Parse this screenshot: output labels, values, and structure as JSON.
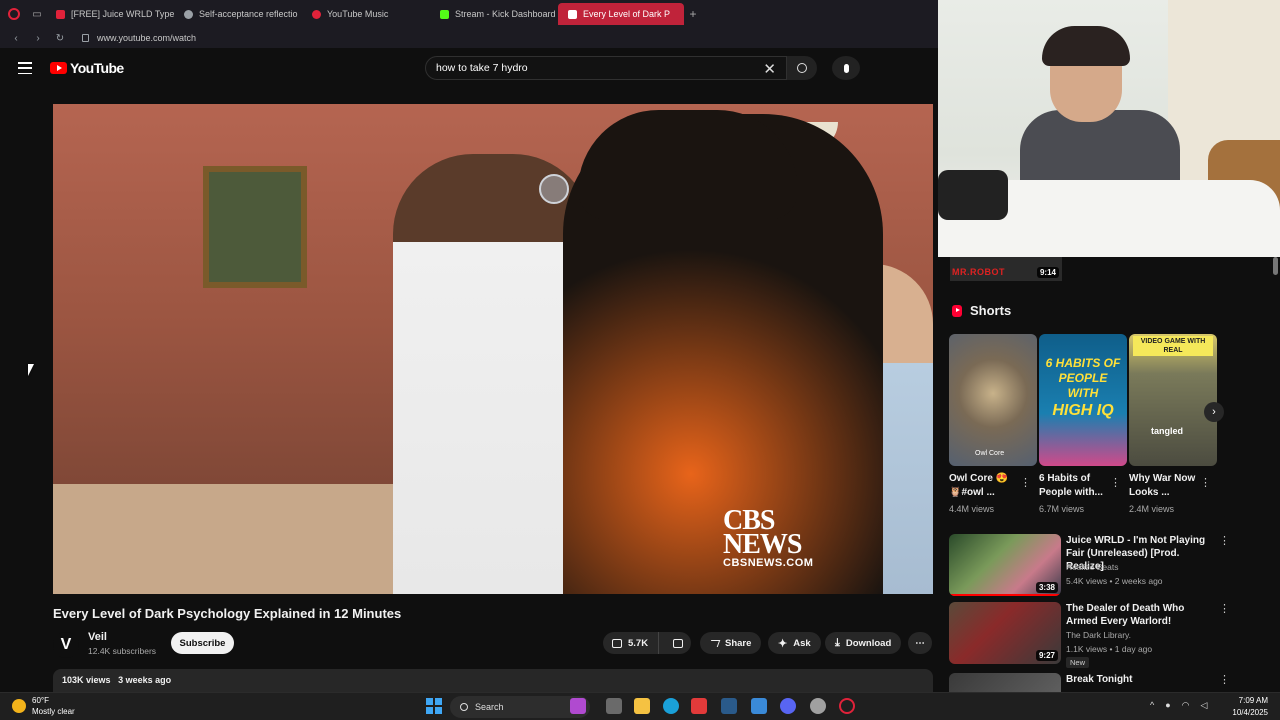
{
  "browser": {
    "tabs": [
      {
        "label": "[FREE] Juice WRLD Type",
        "color": "#e0223a",
        "active": false
      },
      {
        "label": "Self-acceptance reflectio",
        "color": "#9aa0a6",
        "active": false
      },
      {
        "label": "YouTube Music",
        "color": "#e0223a",
        "active": false
      },
      {
        "label": "Stream - Kick Dashboard",
        "color": "#53fc18",
        "active": false
      },
      {
        "label": "Every Level of Dark P",
        "color": "#ffffff",
        "active": true
      }
    ],
    "new_tab_label": "+",
    "url": "www.youtube.com/watch"
  },
  "youtube": {
    "logo_text": "YouTube",
    "search_value": "how to take 7 hydro",
    "clear_glyph": "✕"
  },
  "player": {
    "watermark_big": "CBS",
    "watermark_big2": "NEWS",
    "watermark_small": "CBSNEWS.COM"
  },
  "video": {
    "title": "Every Level of Dark Psychology Explained in 12 Minutes",
    "channel_initial": "V",
    "channel_name": "Veil",
    "subscribers": "12.4K subscribers",
    "subscribe_label": "Subscribe",
    "likes": "5.7K",
    "share_label": "Share",
    "ask_label": "Ask",
    "download_label": "Download",
    "more_glyph": "⋯",
    "views": "103K views",
    "age": "3 weeks ago"
  },
  "sidebar": {
    "prev_thumb_text": "MR.ROBOT",
    "prev_duration": "9:14",
    "shorts_title": "Shorts",
    "shorts": [
      {
        "title": "Owl Core 😍 🦉#owl ...",
        "views": "4.4M views",
        "overlay": "Owl Core"
      },
      {
        "title": "6 Habits of People with...",
        "views": "6.7M views",
        "overlay_top": "6 HABITS OF PEOPLE WITH",
        "overlay_big": "HIGH IQ"
      },
      {
        "title": "Why War Now Looks ...",
        "views": "2.4M views",
        "overlay_top": "VIDEO GAME WITH REAL",
        "overlay_tag": "tangled"
      }
    ],
    "recommended": [
      {
        "title": "Juice WRLD - I'm Not Playing Fair (Unreleased) [Prod. Realize]",
        "channel": "Realize Beats",
        "meta": "5.4K views • 2 weeks ago",
        "duration": "3:38",
        "badge": ""
      },
      {
        "title": "The Dealer of Death Who Armed Every Warlord!",
        "channel": "The Dark Library.",
        "meta": "1.1K views • 1 day ago",
        "duration": "9:27",
        "badge": "New"
      },
      {
        "title": "Break Tonight",
        "channel": "",
        "meta": "",
        "duration": "",
        "badge": ""
      }
    ]
  },
  "taskbar": {
    "temperature": "60°F",
    "weather": "Mostly clear",
    "search_label": "Search",
    "time": "7:09 AM",
    "date": "10/4/2025"
  }
}
